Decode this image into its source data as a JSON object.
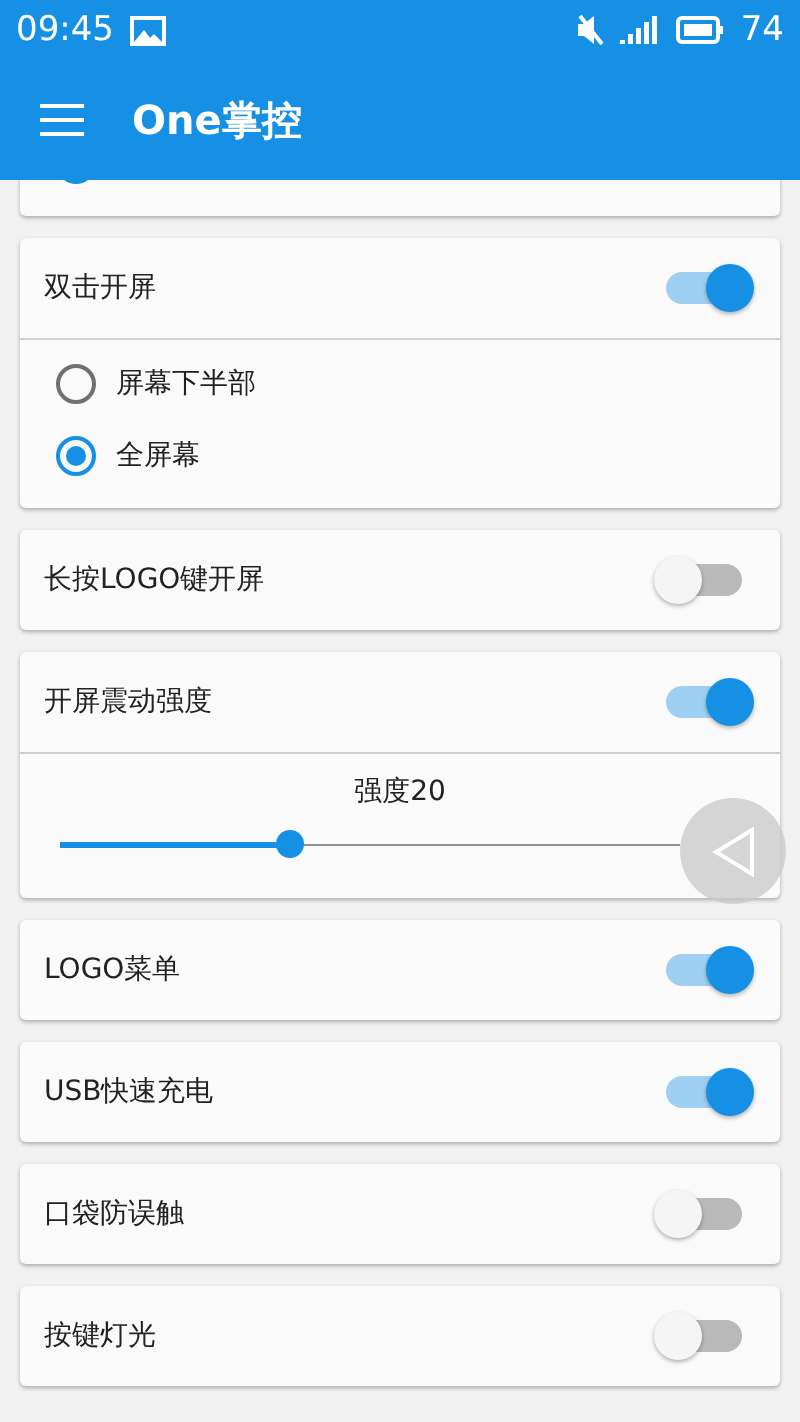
{
  "status_bar": {
    "time": "09:45",
    "battery": "74"
  },
  "app_bar": {
    "title": "One掌控"
  },
  "cards": [
    {
      "kind": "radios",
      "options": [
        {
          "selected": true
        }
      ]
    },
    {
      "kind": "toggle",
      "label": "双击开屏",
      "on": true,
      "options": [
        {
          "label": "屏幕下半部",
          "selected": false
        },
        {
          "label": "全屏幕",
          "selected": true
        }
      ]
    },
    {
      "kind": "toggle",
      "label": "长按LOGO键开屏",
      "on": false
    },
    {
      "kind": "slider",
      "label": "开屏震动强度",
      "on": true,
      "reading": "强度20",
      "level": 0.37
    },
    {
      "kind": "toggle",
      "label": "LOGO菜单",
      "on": true
    },
    {
      "kind": "toggle",
      "label": "USB快速充电",
      "on": true
    },
    {
      "kind": "toggle",
      "label": "口袋防误触",
      "on": false
    },
    {
      "kind": "toggle",
      "label": "按键灯光",
      "on": false
    }
  ]
}
